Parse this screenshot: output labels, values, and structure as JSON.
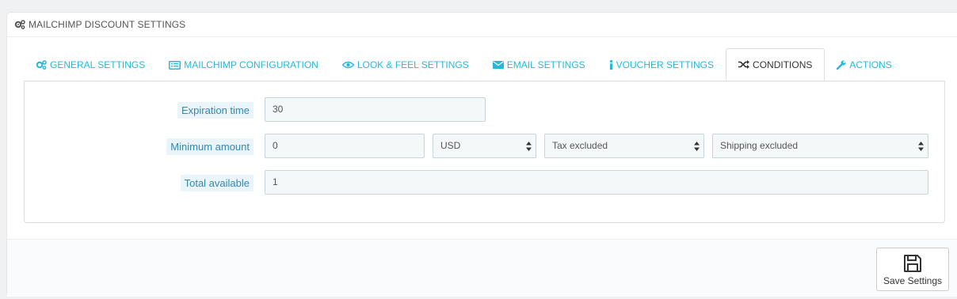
{
  "panel": {
    "title": "MAILCHIMP DISCOUNT SETTINGS"
  },
  "tabs": [
    {
      "label": "GENERAL SETTINGS",
      "icon": "cogs-icon"
    },
    {
      "label": "MAILCHIMP CONFIGURATION",
      "icon": "list-alt-icon"
    },
    {
      "label": "LOOK & FEEL SETTINGS",
      "icon": "eye-icon"
    },
    {
      "label": "EMAIL SETTINGS",
      "icon": "envelope-icon"
    },
    {
      "label": "VOUCHER SETTINGS",
      "icon": "info-icon"
    },
    {
      "label": "CONDITIONS",
      "icon": "random-icon",
      "active": true
    },
    {
      "label": "ACTIONS",
      "icon": "wrench-icon"
    }
  ],
  "form": {
    "expiration": {
      "label": "Expiration time",
      "value": "30"
    },
    "minimum": {
      "label": "Minimum amount",
      "value": "0",
      "currency": "USD",
      "tax": "Tax excluded",
      "shipping": "Shipping excluded"
    },
    "total": {
      "label": "Total available",
      "value": "1"
    }
  },
  "footer": {
    "save_label": "Save Settings"
  },
  "colors": {
    "accent": "#25b9d7",
    "label_bg": "#eaf4fb",
    "label_text": "#3586ae"
  }
}
